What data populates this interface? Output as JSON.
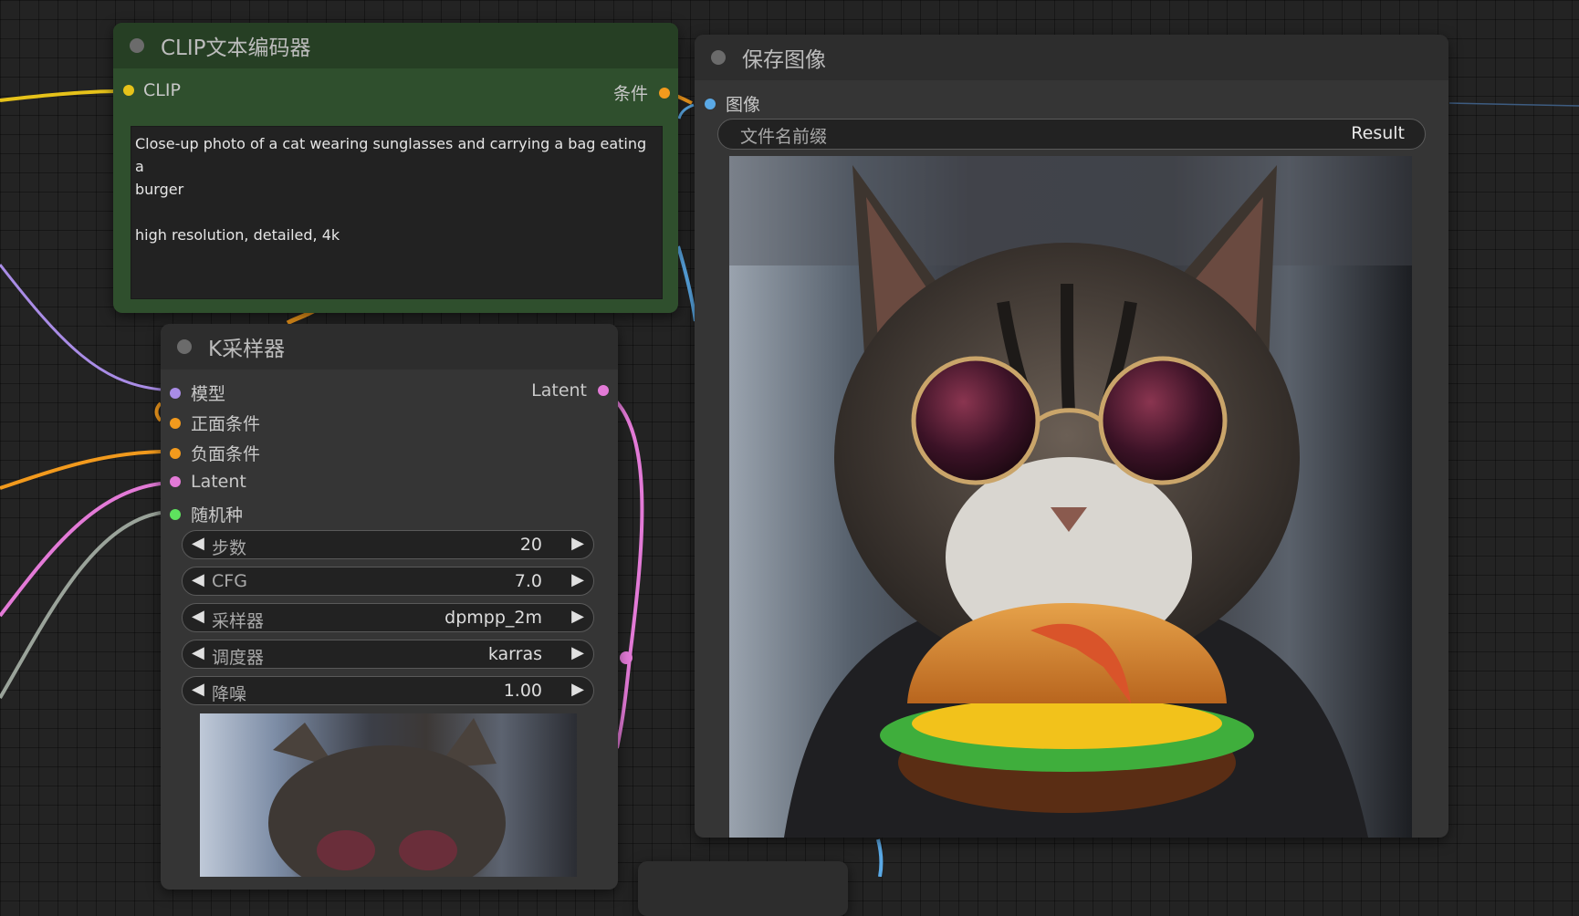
{
  "clip_node": {
    "title": "CLIP文本编码器",
    "input_clip": "CLIP",
    "output_condition": "条件",
    "prompt_line1": "Close-up photo of a cat wearing sunglasses and carrying a bag eating a",
    "prompt_line2": "burger",
    "prompt_line3": "high resolution, detailed, 4k"
  },
  "ksampler_node": {
    "title": "K采样器",
    "inputs": [
      "模型",
      "正面条件",
      "负面条件",
      "Latent",
      "随机种"
    ],
    "output_latent": "Latent",
    "widgets": [
      {
        "label": "步数",
        "value": "20"
      },
      {
        "label": "CFG",
        "value": "7.0"
      },
      {
        "label": "采样器",
        "value": "dpmpp_2m"
      },
      {
        "label": "调度器",
        "value": "karras"
      },
      {
        "label": "降噪",
        "value": "1.00"
      }
    ]
  },
  "save_node": {
    "title": "保存图像",
    "input_image": "图像",
    "filename_label": "文件名前缀",
    "filename_value": "Result"
  },
  "icons": {
    "left_arrow": "◀",
    "right_arrow": "▶"
  },
  "colors": {
    "clip_node_body": "#2f4f2d",
    "clip_node_title": "#263f24",
    "node_body": "#353535",
    "node_title": "#2d2d2d",
    "wire_yellow": "#e6c21a",
    "wire_orange": "#f29a1d",
    "wire_purple": "#a98ce6",
    "wire_pink": "#e37ad7",
    "wire_blue": "#5aa9e6",
    "wire_gray": "#9aa39a",
    "dot_green": "#5ee35e"
  }
}
